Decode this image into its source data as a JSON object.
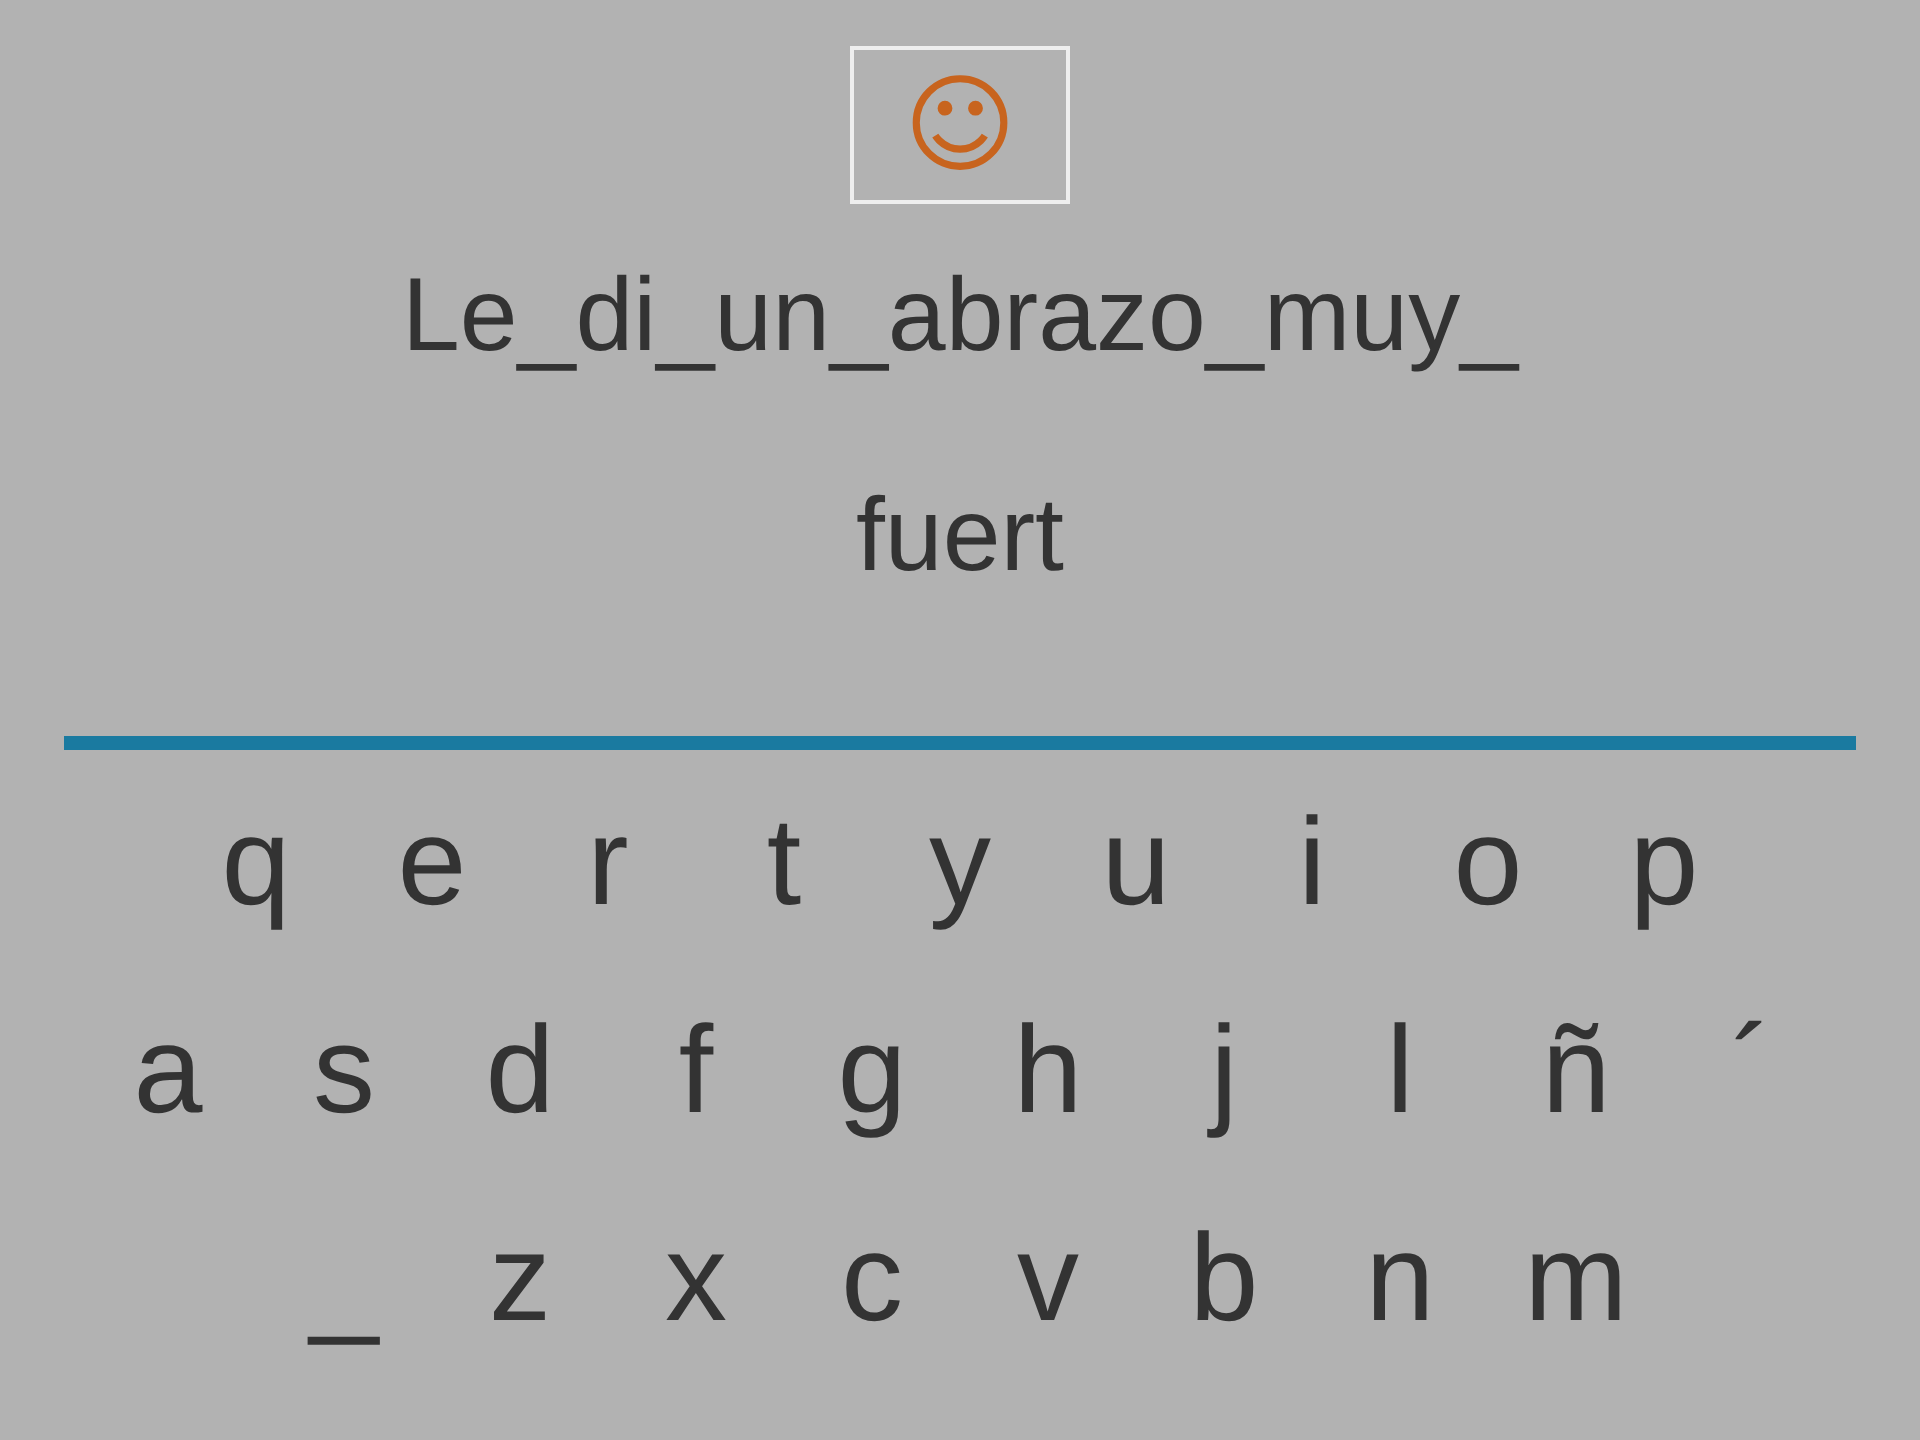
{
  "feedback": {
    "symbol": "☺"
  },
  "sentence": {
    "lines": [
      "Le_di_un_abrazo_muy_",
      "fuert"
    ]
  },
  "keyboard": {
    "rows": [
      [
        "q",
        "e",
        "r",
        "t",
        "y",
        "u",
        "i",
        "o",
        "p"
      ],
      [
        "a",
        "s",
        "d",
        "f",
        "g",
        "h",
        "j",
        "l",
        "ñ",
        "´"
      ],
      [
        "_",
        "z",
        "x",
        "c",
        "v",
        "b",
        "n",
        "m"
      ]
    ]
  }
}
